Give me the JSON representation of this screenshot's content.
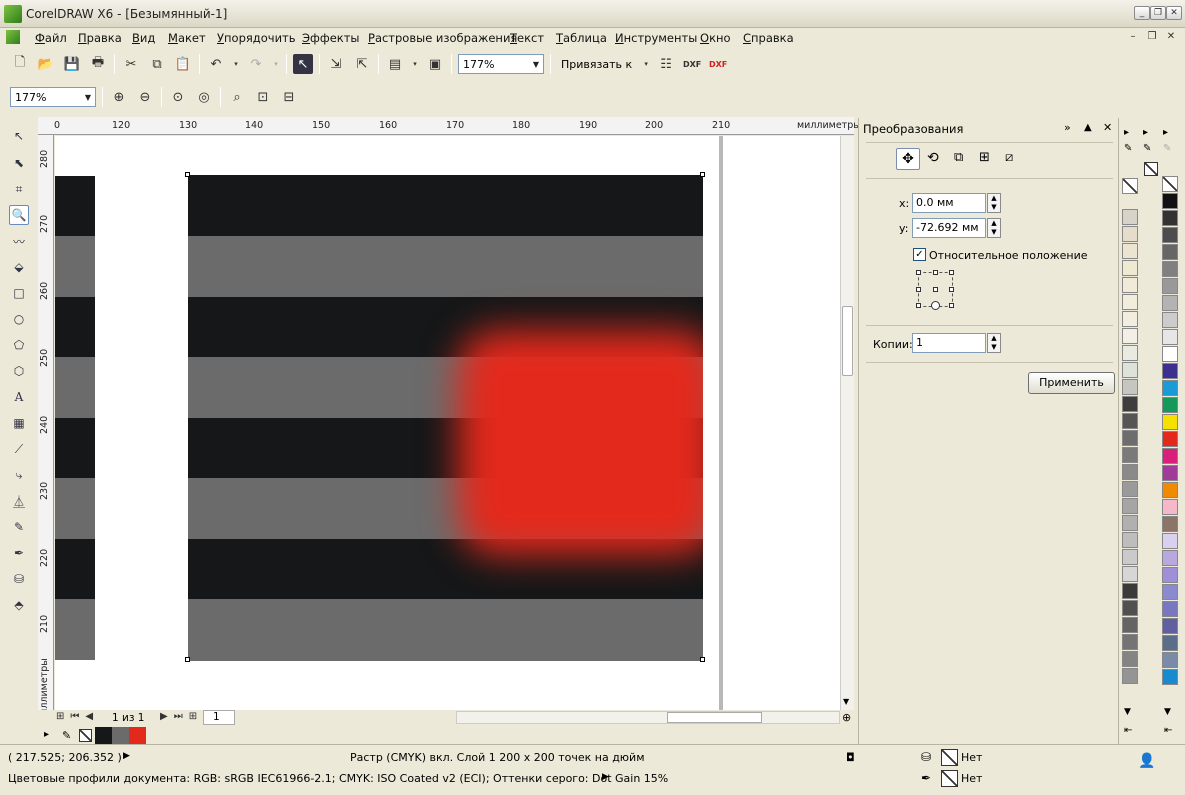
{
  "window": {
    "title": "CorelDRAW X6 - [Безымянный-1]"
  },
  "menu": [
    "Файл",
    "Правка",
    "Вид",
    "Макет",
    "Упорядочить",
    "Эффекты",
    "Растровые изображения",
    "Текст",
    "Таблица",
    "Инструменты",
    "Окно",
    "Справка"
  ],
  "toolbar": {
    "zoom": "177%",
    "snap": "Привязать к"
  },
  "propbar": {
    "zoom": "177%"
  },
  "ruler": {
    "unit": "миллиметры",
    "h": [
      "0",
      "120",
      "130",
      "140",
      "150",
      "160",
      "170",
      "180",
      "190",
      "200",
      "210"
    ],
    "v": [
      "280",
      "270",
      "260",
      "250",
      "240",
      "230",
      "220",
      "210"
    ]
  },
  "docker": {
    "title": "Преобразования",
    "x_label": "x:",
    "x_value": "0.0 мм",
    "y_label": "y:",
    "y_value": "-72.692 мм",
    "relative_label": "Относительное положение",
    "copies_label": "Копии:",
    "copies_value": "1",
    "apply": "Применить"
  },
  "pagenav": {
    "count": "1 из 1",
    "tab": "1"
  },
  "status": {
    "coords": "( 217.525; 206.352 )",
    "info": "Растр (CMYK) вкл. Слой 1 200 x 200 точек на дюйм",
    "profiles": "Цветовые профили документа: RGB: sRGB IEC61966-2.1; CMYK: ISO Coated v2 (ECI); Оттенки серого: Dot Gain 15%",
    "fill": "Нет",
    "outline": "Нет"
  },
  "colors": {
    "dark": "#151718",
    "gray": "#6b6b6b",
    "red": "#e3291c"
  },
  "palette_gray": [
    "#d8d3c8",
    "#e6dccb",
    "#ece4cf",
    "#efe9d4",
    "#f0ead8",
    "#f1ecdc",
    "#f2eedf",
    "#f3efe6",
    "#e9ebe0",
    "#dde3d9",
    "#c4c6bf",
    "#3e3e3e",
    "#555",
    "#6d6d6d",
    "#7a7a7a",
    "#8a8a8a",
    "#9a9a9a",
    "#a5a5a5",
    "#b0b0b0",
    "#bdbdbd",
    "#cacaca",
    "#d6d6d6",
    "#3a3a3a",
    "#505050",
    "#646464",
    "#747474",
    "#848484",
    "#949494"
  ],
  "palette_color": [
    "#111",
    "#333",
    "#4d4d4d",
    "#666",
    "#808080",
    "#999",
    "#b3b3b3",
    "#ccc",
    "#e6e6e6",
    "#fff",
    "#3b2f8f",
    "#1a9bd6",
    "#14995a",
    "#f5e000",
    "#e3291c",
    "#d8207a",
    "#a03b99",
    "#f08a00",
    "#f5b8c8",
    "#8c7466",
    "#d8d0ee",
    "#b8a8de",
    "#9f8fd8",
    "#8a8ad0",
    "#7878c0",
    "#6060a0",
    "#5a6e8a",
    "#7a8aa8",
    "#1a8ad0"
  ]
}
